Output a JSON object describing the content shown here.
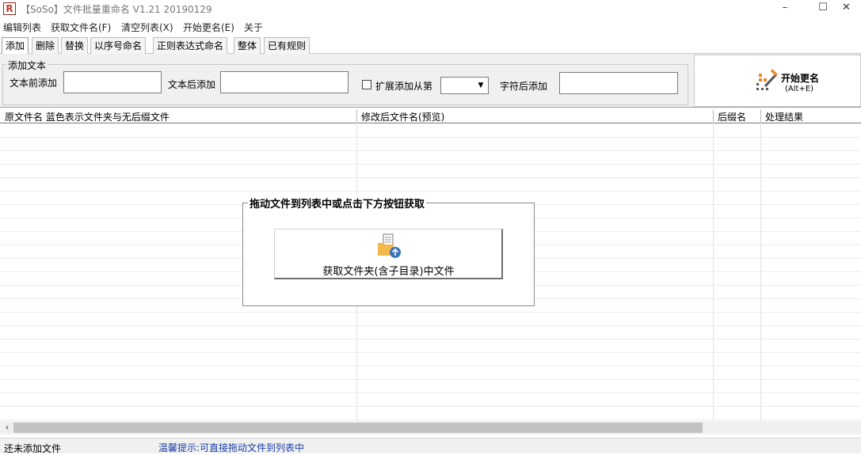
{
  "window": {
    "app_icon_letter": "R",
    "title": "【SoSo】文件批量重命名   V1.21 20190129",
    "minimize": "–",
    "maximize": "☐",
    "close": "✕"
  },
  "menu": [
    "编辑列表",
    "获取文件名(F)",
    "清空列表(X)",
    "开始更名(E)",
    "关于"
  ],
  "tabs": [
    "添加",
    "删除",
    "替换",
    "以序号命名",
    "正则表达式命名",
    "整体",
    "已有规则"
  ],
  "active_tab": "添加",
  "add_text_group": {
    "legend": "添加文本",
    "prefix_label": "文本前添加",
    "prefix_value": "",
    "suffix_label": "文本后添加",
    "suffix_value": "",
    "expand_label": "扩展添加从第",
    "expand_checked": false,
    "position_value": "",
    "after_char_label": "字符后添加",
    "after_char_value": ""
  },
  "rename_button": {
    "label": "开始更名",
    "shortcut": "(Alt+E)"
  },
  "list_columns": [
    "原文件名  蓝色表示文件夹与无后缀文件",
    "修改后文件名(预览)",
    "后缀名",
    "处理结果"
  ],
  "drop_area": {
    "title": "拖动文件到列表中或点击下方按钮获取",
    "button_label": "获取文件夹(含子目录)中文件"
  },
  "scrollbar": {
    "left_arrow": "‹"
  },
  "status": {
    "left": "还未添加文件",
    "tip": "温馨提示:可直接拖动文件到列表中"
  },
  "colors": {
    "tip_text": "#1a3ea8",
    "app_icon": "#c0392b",
    "icon_orange": "#e8892b",
    "icon_blue": "#3b73b9"
  }
}
